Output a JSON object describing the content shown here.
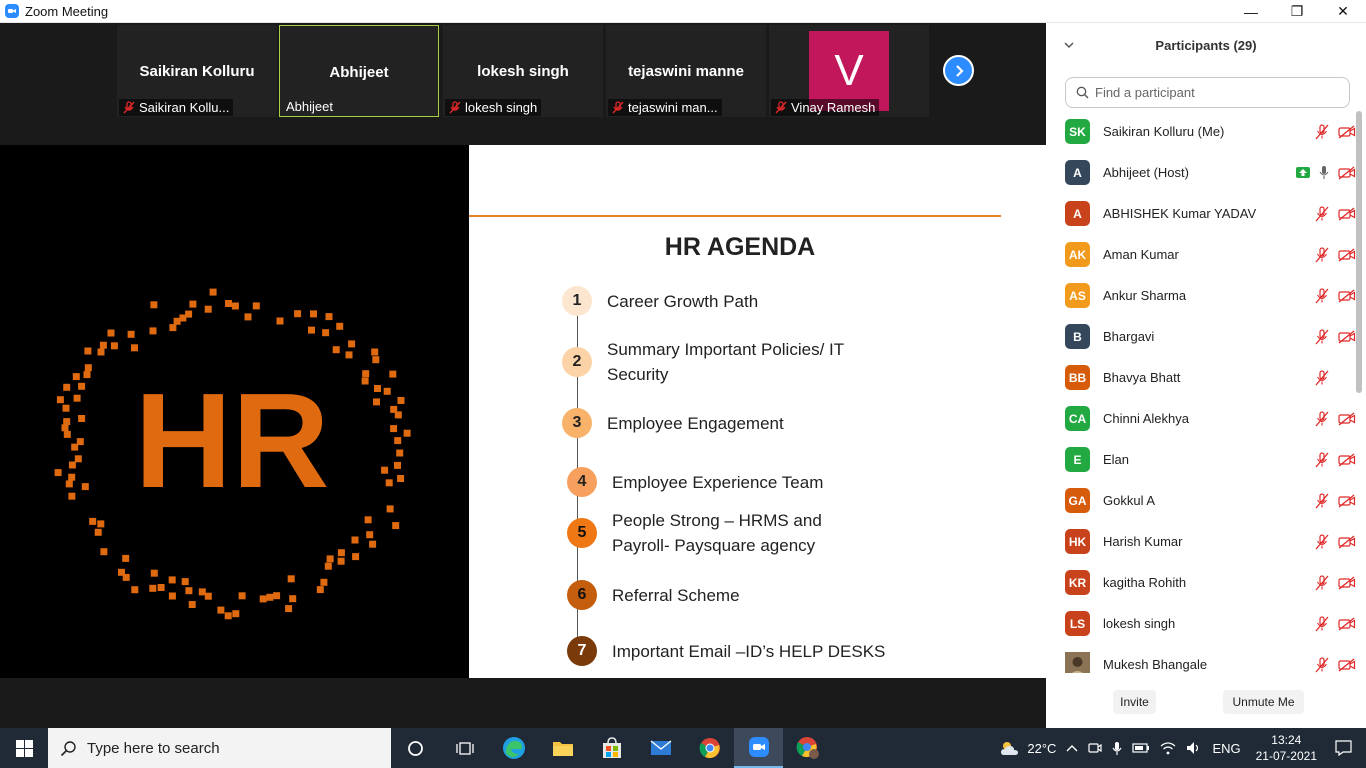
{
  "window": {
    "title": "Zoom Meeting",
    "minimize": "—",
    "restore": "❐",
    "close": "✕"
  },
  "video_strip": {
    "tiles": [
      {
        "big_name": "Saikiran Kolluru",
        "label": "Saikiran Kollu...",
        "muted": true
      },
      {
        "big_name": "Abhijeet",
        "label": "Abhijeet",
        "muted": false
      },
      {
        "big_name": "lokesh singh",
        "label": "lokesh singh",
        "muted": true
      },
      {
        "big_name": "tejaswini manne",
        "label": "tejaswini man...",
        "muted": true
      },
      {
        "avatar_letter": "V",
        "label": "Vinay Ramesh",
        "muted": true
      }
    ]
  },
  "slide": {
    "logo_text": "HR",
    "title": "HR AGENDA",
    "items": [
      {
        "num": "1",
        "text": "Career Growth Path"
      },
      {
        "num": "2",
        "text_line1": "Summary Important Policies/ IT",
        "text_line2": "Security"
      },
      {
        "num": "3",
        "text": "Employee  Engagement"
      },
      {
        "num": "4",
        "text": "Employee Experience Team"
      },
      {
        "num": "5",
        "text_line1": "People Strong – HRMS and",
        "text_line2": "Payroll- Paysquare agency"
      },
      {
        "num": "6",
        "text": "Referral Scheme"
      },
      {
        "num": "7",
        "text": "Important Email –ID’s HELP DESKS"
      }
    ]
  },
  "participants_panel": {
    "header": "Participants (29)",
    "search_placeholder": "Find a participant",
    "participants": [
      {
        "initials": "SK",
        "name": "Saikiran Kolluru (Me)",
        "color": "#23a942"
      },
      {
        "initials": "A",
        "name": "Abhijeet (Host)",
        "color": "#34475b"
      },
      {
        "initials": "A",
        "name": "ABHISHEK Kumar YADAV",
        "color": "#c8431c"
      },
      {
        "initials": "AK",
        "name": "Aman Kumar",
        "color": "#f19a1b"
      },
      {
        "initials": "AS",
        "name": "Ankur Sharma",
        "color": "#f19a1b"
      },
      {
        "initials": "B",
        "name": "Bhargavi",
        "color": "#34475b"
      },
      {
        "initials": "BB",
        "name": "Bhavya Bhatt",
        "color": "#d65b0a"
      },
      {
        "initials": "CA",
        "name": "Chinni Alekhya",
        "color": "#23a942"
      },
      {
        "initials": "E",
        "name": "Elan",
        "color": "#23a942"
      },
      {
        "initials": "GA",
        "name": "Gokkul A",
        "color": "#d65b0a"
      },
      {
        "initials": "HK",
        "name": "Harish Kumar",
        "color": "#c8431c"
      },
      {
        "initials": "KR",
        "name": "kagitha Rohith",
        "color": "#c8431c"
      },
      {
        "initials": "LS",
        "name": "lokesh singh",
        "color": "#c8431c"
      },
      {
        "initials": "",
        "name": "Mukesh Bhangale",
        "color": "#6b5a3e"
      }
    ],
    "invite_label": "Invite",
    "unmute_label": "Unmute Me"
  },
  "taskbar": {
    "search_placeholder": "Type here to search",
    "temperature": "22°C",
    "language": "ENG",
    "time": "13:24",
    "date": "21-07-2021"
  }
}
